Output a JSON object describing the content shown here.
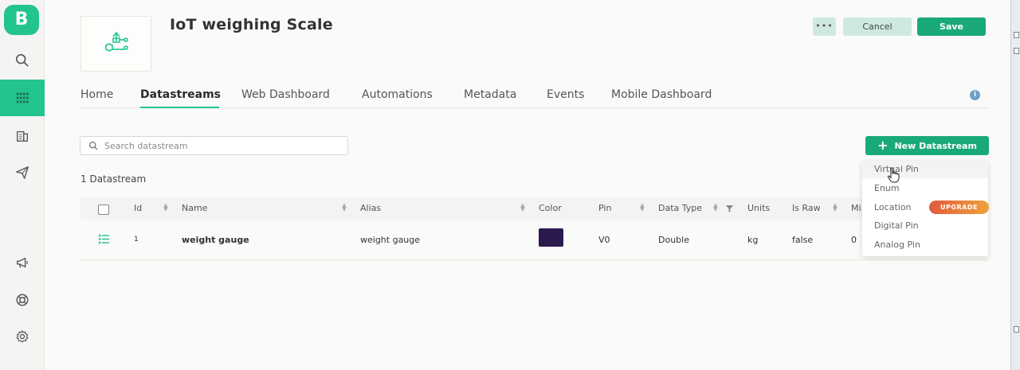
{
  "app": {
    "logo_letter": "B",
    "brand_color": "#23c48e",
    "accent_dark": "#1aa979"
  },
  "sidebar": {
    "items": [
      {
        "icon": "search-icon",
        "active": false
      },
      {
        "icon": "grid-icon",
        "active": true
      },
      {
        "icon": "building-icon",
        "active": false
      },
      {
        "icon": "send-icon",
        "active": false
      },
      {
        "icon": "megaphone-icon",
        "active": false
      },
      {
        "icon": "lifebuoy-icon",
        "active": false
      },
      {
        "icon": "gear-icon",
        "active": false
      }
    ]
  },
  "header": {
    "title": "IoT weighing Scale",
    "more_label": "•••",
    "cancel_label": "Cancel",
    "save_label": "Save"
  },
  "tabs": [
    {
      "label": "Home",
      "active": false
    },
    {
      "label": "Datastreams",
      "active": true
    },
    {
      "label": "Web Dashboard",
      "active": false
    },
    {
      "label": "Automations",
      "active": false
    },
    {
      "label": "Metadata",
      "active": false
    },
    {
      "label": "Events",
      "active": false
    },
    {
      "label": "Mobile Dashboard",
      "active": false
    }
  ],
  "info_icon": "i",
  "search": {
    "placeholder": "Search datastream",
    "value": ""
  },
  "datastream_count": "1 Datastream",
  "new_datastream": {
    "plus": "+",
    "label": "New Datastream"
  },
  "table": {
    "columns": [
      "Id",
      "Name",
      "Alias",
      "Color",
      "Pin",
      "Data Type",
      "Units",
      "Is Raw",
      "Mi"
    ],
    "rows": [
      {
        "icon": "datastream-icon",
        "id": "1",
        "name": "weight gauge",
        "alias": "weight gauge",
        "color": "#2a1a4e",
        "pin": "V0",
        "data_type": "Double",
        "units": "kg",
        "is_raw": "false",
        "min": "0"
      }
    ]
  },
  "dropdown": {
    "items": [
      "Virtual Pin",
      "Enum",
      "Location",
      "Digital Pin",
      "Analog Pin"
    ],
    "upgrade_badge": "UPGRADE"
  }
}
